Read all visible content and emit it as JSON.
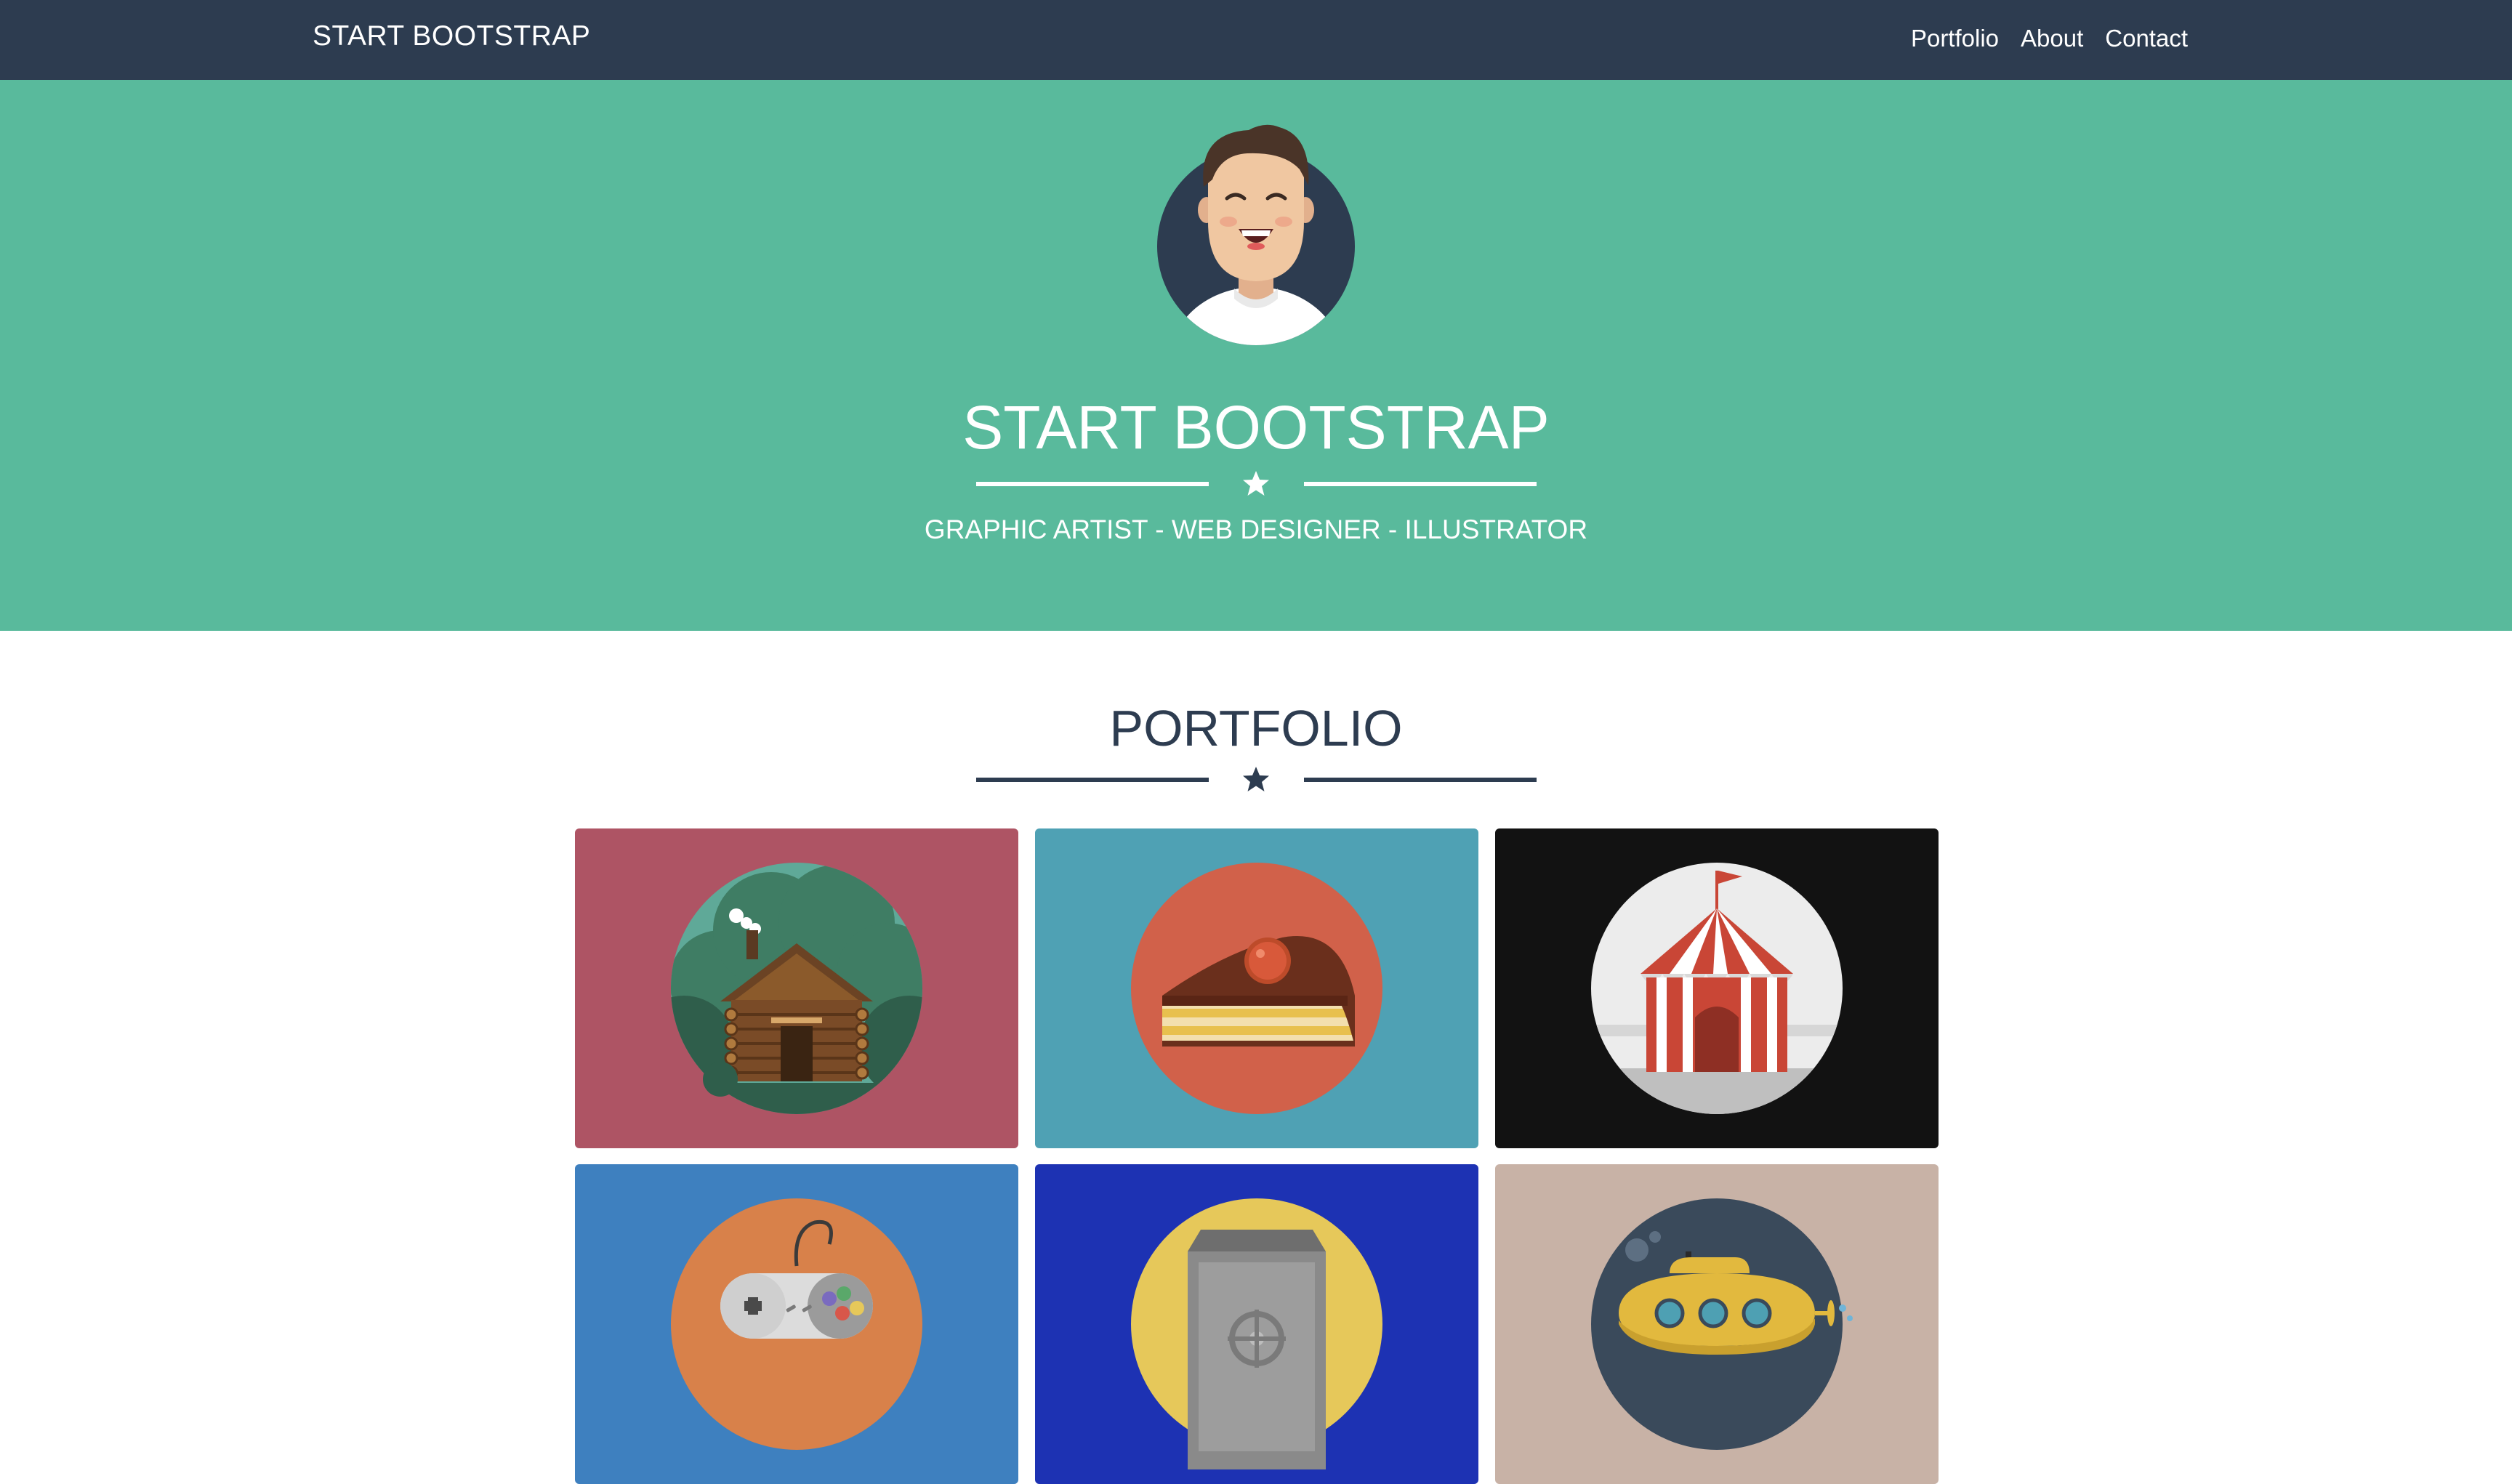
{
  "navbar": {
    "brand": "START BOOTSTRAP",
    "links": [
      "Portfolio",
      "About",
      "Contact"
    ]
  },
  "masthead": {
    "title": "START BOOTSTRAP",
    "subtitle": "GRAPHIC ARTIST - WEB DESIGNER - ILLUSTRATOR",
    "divider_icon": "star-icon",
    "avatar_icon": "avatar-illustration"
  },
  "portfolio": {
    "title": "PORTFOLIO",
    "divider_icon": "star-icon",
    "items": [
      {
        "name": "cabin",
        "icon": "cabin-icon",
        "bg": "#ae5464",
        "circle": "#5fa998"
      },
      {
        "name": "cake",
        "icon": "cake-icon",
        "bg": "#4fa1b4",
        "circle": "#d1614a"
      },
      {
        "name": "circus",
        "icon": "circus-tent-icon",
        "bg": "#121212",
        "circle": "#ececec"
      },
      {
        "name": "game",
        "icon": "game-controller-icon",
        "bg": "#3e80bf",
        "circle": "#d8814a"
      },
      {
        "name": "safe",
        "icon": "safe-icon",
        "bg": "#1d32b3",
        "circle": "#e6c85a"
      },
      {
        "name": "submarine",
        "icon": "submarine-icon",
        "bg": "#c8b2a6",
        "circle": "#3a4a5b"
      }
    ]
  },
  "colors": {
    "navbar": "#2d3c50",
    "primary": "#59ba9c",
    "text_dark": "#2d3c50"
  }
}
